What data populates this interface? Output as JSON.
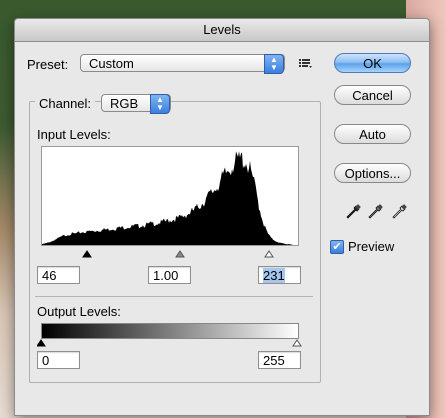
{
  "dialog": {
    "title": "Levels"
  },
  "preset": {
    "label": "Preset:",
    "value": "Custom"
  },
  "channel": {
    "label": "Channel:",
    "value": "RGB"
  },
  "input_levels": {
    "label": "Input Levels:",
    "black": "46",
    "gamma": "1.00",
    "white": "231"
  },
  "output_levels": {
    "label": "Output Levels:",
    "black": "0",
    "white": "255"
  },
  "buttons": {
    "ok": "OK",
    "cancel": "Cancel",
    "auto": "Auto",
    "options": "Options..."
  },
  "preview": {
    "label": "Preview",
    "checked": true
  },
  "icons": {
    "preset_menu": "list-menu-icon",
    "eyedroppers": [
      "black-eyedropper-icon",
      "gray-eyedropper-icon",
      "white-eyedropper-icon"
    ]
  },
  "histogram": [
    0.01,
    0.02,
    0.03,
    0.05,
    0.07,
    0.09,
    0.11,
    0.12,
    0.13,
    0.13,
    0.14,
    0.15,
    0.15,
    0.16,
    0.16,
    0.17,
    0.17,
    0.18,
    0.18,
    0.19,
    0.19,
    0.2,
    0.2,
    0.21,
    0.21,
    0.22,
    0.22,
    0.23,
    0.23,
    0.24,
    0.25,
    0.25,
    0.26,
    0.27,
    0.28,
    0.29,
    0.3,
    0.31,
    0.33,
    0.35,
    0.37,
    0.4,
    0.43,
    0.47,
    0.51,
    0.56,
    0.61,
    0.66,
    0.72,
    0.78,
    0.84,
    0.9,
    0.95,
    0.98,
    1.0,
    0.97,
    0.9,
    0.78,
    0.6,
    0.4,
    0.24,
    0.14,
    0.08,
    0.05,
    0.03,
    0.02,
    0.01,
    0.01,
    0.0,
    0.0
  ]
}
